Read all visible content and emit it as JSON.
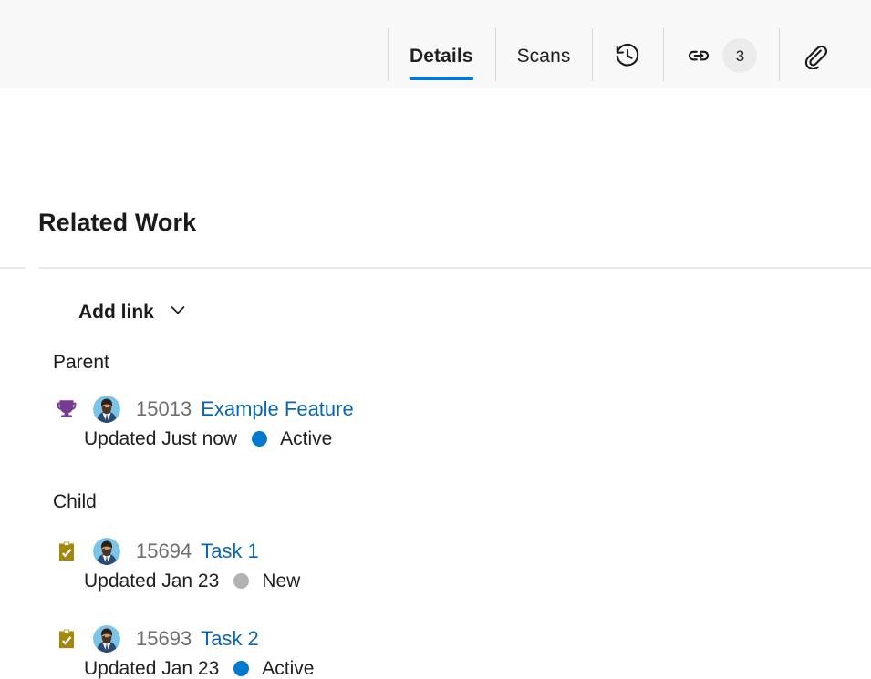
{
  "header": {
    "tabs": [
      {
        "label": "Details",
        "active": true
      },
      {
        "label": "Scans",
        "active": false
      }
    ],
    "icon_tabs": [
      {
        "icon": "history-icon",
        "badge": ""
      },
      {
        "icon": "link-icon",
        "badge": "3"
      },
      {
        "icon": "attachment-icon",
        "badge": ""
      }
    ]
  },
  "section": {
    "title": "Related Work",
    "add_link_label": "Add link",
    "add_link_chevron": "chevron-down-icon"
  },
  "groups": [
    {
      "label": "Parent",
      "items": [
        {
          "type_icon": "feature-trophy-icon",
          "type_color": "#773b93",
          "avatar": "person-avatar",
          "id": "15013",
          "title": "Example Feature",
          "updated": "Updated Just now",
          "state": "Active",
          "state_color": "#007acc"
        }
      ]
    },
    {
      "label": "Child",
      "items": [
        {
          "type_icon": "task-clipboard-icon",
          "type_color": "#a4880a",
          "avatar": "person-avatar",
          "id": "15694",
          "title": "Task 1",
          "updated": "Updated Jan 23",
          "state": "New",
          "state_color": "#b2b2b2"
        },
        {
          "type_icon": "task-clipboard-icon",
          "type_color": "#a4880a",
          "avatar": "person-avatar",
          "id": "15693",
          "title": "Task 2",
          "updated": "Updated Jan 23",
          "state": "Active",
          "state_color": "#007acc"
        }
      ]
    }
  ],
  "colors": {
    "accent": "#0078d4",
    "link": "#0a66b5",
    "header_bg": "#f8f8f8",
    "divider": "#eaeaea",
    "id_text": "#6e6e6e"
  }
}
